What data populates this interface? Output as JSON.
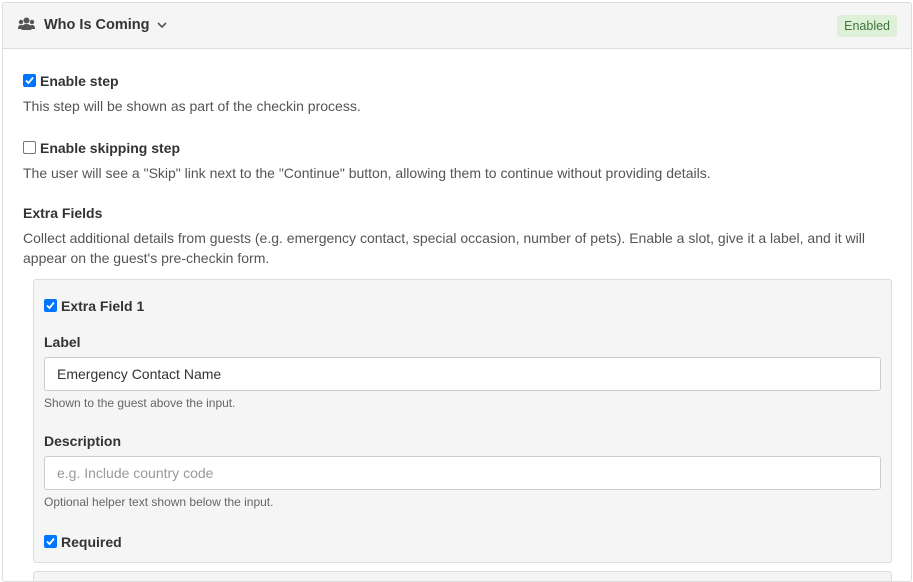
{
  "header": {
    "title": "Who Is Coming",
    "icon": "users-icon",
    "status": "Enabled",
    "status_colors": {
      "bg": "#dff0d8",
      "fg": "#3c763d"
    }
  },
  "enable_step": {
    "label": "Enable step",
    "checked": true,
    "help": "This step will be shown as part of the checkin process."
  },
  "enable_skipping": {
    "label": "Enable skipping step",
    "checked": false,
    "help": "The user will see a \"Skip\" link next to the \"Continue\" button, allowing them to continue without providing details."
  },
  "extra_fields": {
    "title": "Extra Fields",
    "help": "Collect additional details from guests (e.g. emergency contact, special occasion, number of pets). Enable a slot, give it a label, and it will appear on the guest's pre-checkin form.",
    "slots": [
      {
        "label": "Extra Field 1",
        "checked": true,
        "label_field": {
          "label": "Label",
          "value": "Emergency Contact Name",
          "help": "Shown to the guest above the input."
        },
        "description_field": {
          "label": "Description",
          "value": "",
          "placeholder": "e.g. Include country code",
          "help": "Optional helper text shown below the input."
        },
        "required": {
          "label": "Required",
          "checked": true
        }
      }
    ]
  },
  "colors": {
    "accent": "#0075ff",
    "panel_bg": "#f5f5f5",
    "border": "#dddddd"
  }
}
